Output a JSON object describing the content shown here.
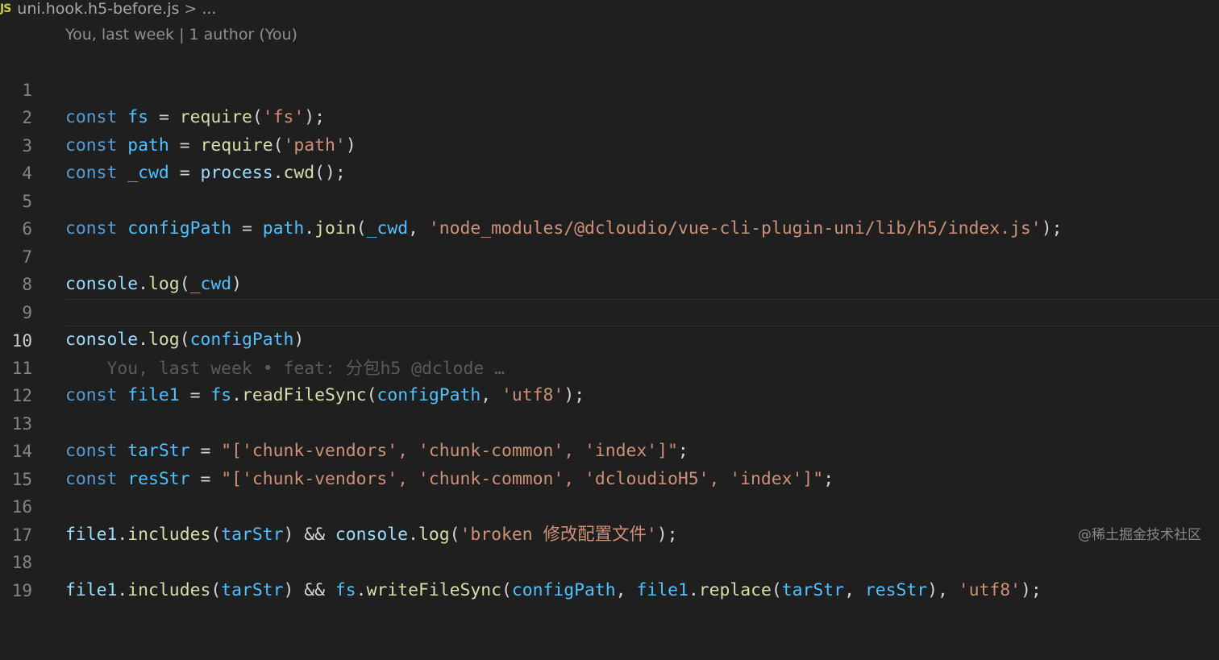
{
  "breadcrumb": {
    "badge": "JS",
    "file": "uni.hook.h5-before.js",
    "chevron": ">",
    "more": "..."
  },
  "codelens": {
    "text": "You, last week | 1 author (You)"
  },
  "inline_blame": {
    "text": "You, last week • feat: 分包h5 @dclode …"
  },
  "current_line": 10,
  "lines": [
    {
      "n": "1"
    },
    {
      "n": "2"
    },
    {
      "n": "3"
    },
    {
      "n": "4"
    },
    {
      "n": "5"
    },
    {
      "n": "6"
    },
    {
      "n": "7"
    },
    {
      "n": "8"
    },
    {
      "n": "9"
    },
    {
      "n": "10"
    },
    {
      "n": "11"
    },
    {
      "n": "12"
    },
    {
      "n": "13"
    },
    {
      "n": "14"
    },
    {
      "n": "15"
    },
    {
      "n": "16"
    },
    {
      "n": "17"
    },
    {
      "n": "18"
    },
    {
      "n": "19"
    }
  ],
  "tokens": {
    "const": "const",
    "fs": "fs",
    "path": "path",
    "cwd": "_cwd",
    "configPath": "configPath",
    "file1": "file1",
    "tarStr": "tarStr",
    "resStr": "resStr",
    "require": "require",
    "process": "process",
    "cwd_fn": "cwd",
    "join": "join",
    "console": "console",
    "log": "log",
    "readFileSync": "readFileSync",
    "includes": "includes",
    "writeFileSync": "writeFileSync",
    "replace": "replace",
    "s_fs": "'fs'",
    "s_path": "'path'",
    "s_node": "'node_modules/@dcloudio/vue-cli-plugin-uni/lib/h5/index.js'",
    "s_utf8": "'utf8'",
    "s_tar": "\"['chunk-vendors', 'chunk-common', 'index']\"",
    "s_res": "\"['chunk-vendors', 'chunk-common', 'dcloudioH5', 'index']\"",
    "s_broken": "'broken 修改配置文件'",
    "s_utf8_trunc": "'utf8'"
  },
  "watermark": "@稀土掘金技术社区",
  "colors": {
    "background": "#1f1f1f",
    "keyword": "#569cd6",
    "constant_variable": "#4fc1ff",
    "variable": "#9cdcfe",
    "function": "#dcdcaa",
    "string": "#ce9178",
    "line_number": "#858585"
  }
}
